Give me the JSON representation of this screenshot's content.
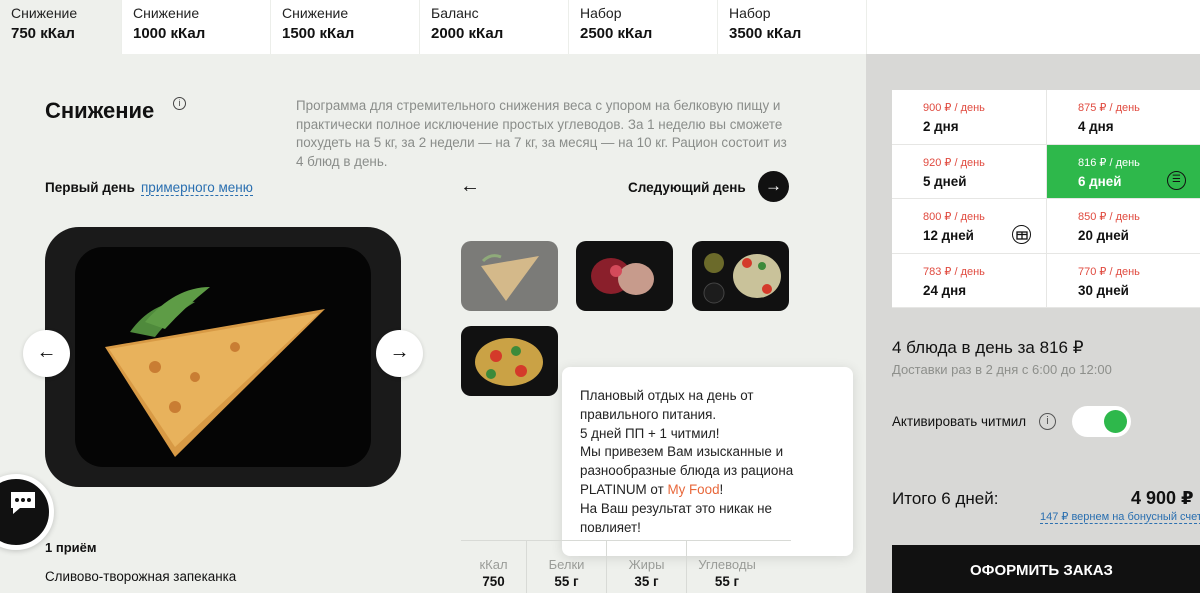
{
  "tabs": [
    {
      "line1": "Снижение",
      "line2": "750 кКал",
      "active": true
    },
    {
      "line1": "Снижение",
      "line2": "1000 кКал"
    },
    {
      "line1": "Снижение",
      "line2": "1500 кКал"
    },
    {
      "line1": "Баланс",
      "line2": "2000 кКал"
    },
    {
      "line1": "Набор",
      "line2": "2500 кКал"
    },
    {
      "line1": "Набор",
      "line2": "3500 кКал"
    }
  ],
  "program": {
    "title": "Снижение",
    "info_icon": "i",
    "description": "Программа для стремительного снижения веса с упором на белковую пищу и практически полное исключение простых углеводов. За 1 неделю вы сможете похудеть на 5 кг, за 2 недели — на 7 кг, за месяц — на 10 кг. Рацион состоит из 4 блюд в день."
  },
  "menu_nav": {
    "first_day": "Первый день",
    "menu_link": "примерного меню",
    "prev_arrow": "←",
    "next_label": "Следующий день",
    "next_arrow": "→"
  },
  "carousel": {
    "prev": "←",
    "next": "→"
  },
  "tooltip": {
    "line1": "Плановый отдых на день от правильного питания.",
    "line2": "5 дней ПП + 1 читмил!",
    "line3": "Мы привезем Вам изысканные и разнообразные блюда из рациона PLATINUM от ",
    "brand": "My Food",
    "line3_end": "!",
    "line4": "На Ваш результат это никак не повлияет!"
  },
  "meal": {
    "number": "1 приём",
    "name": "Сливово-творожная запеканка"
  },
  "nutrition": [
    {
      "label": "кКал",
      "value": "750"
    },
    {
      "label": "Белки",
      "value": "55 г"
    },
    {
      "label": "Жиры",
      "value": "35 г"
    },
    {
      "label": "Углеводы",
      "value": "55 г"
    }
  ],
  "days": [
    {
      "price": "900 ₽ / день",
      "count": "2 дня"
    },
    {
      "price": "875 ₽ / день",
      "count": "4 дня"
    },
    {
      "price": "920 ₽ / день",
      "count": "5 дней"
    },
    {
      "price": "816 ₽ / день",
      "count": "6 дней",
      "selected": true,
      "badge": "☰"
    },
    {
      "price": "800 ₽ / день",
      "count": "12 дней",
      "badge": "🎁"
    },
    {
      "price": "850 ₽ / день",
      "count": "20 дней"
    },
    {
      "price": "783 ₽ / день",
      "count": "24 дня"
    },
    {
      "price": "770 ₽ / день",
      "count": "30 дней"
    }
  ],
  "summary": {
    "text": "4 блюда в день за 816 ₽",
    "delivery": "Доставки раз в 2 дня с 6:00 до 12:00",
    "cheat_label": "Активировать читмил",
    "cheat_info": "i",
    "cheat_enabled": true,
    "total_label": "Итого 6 дней:",
    "total_value": "4 900 ₽",
    "bonus": "147 ₽ вернем на бонусный счет",
    "order_button": "ОФОРМИТЬ ЗАКАЗ"
  },
  "chat_icon": "chat-bubble-icon",
  "colors": {
    "accent_green": "#2eb84b",
    "price_red": "#e04a3f",
    "link_blue": "#2a6fb0",
    "brand_orange": "#e8673a"
  }
}
